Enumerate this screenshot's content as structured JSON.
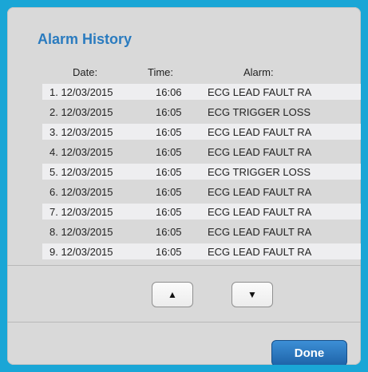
{
  "dialog": {
    "title": "Alarm History",
    "columns": {
      "date": "Date:",
      "time": "Time:",
      "alarm": "Alarm:"
    },
    "rows": [
      {
        "date": "1. 12/03/2015",
        "time": "16:06",
        "alarm": "ECG LEAD FAULT RA"
      },
      {
        "date": "2. 12/03/2015",
        "time": "16:05",
        "alarm": "ECG TRIGGER LOSS"
      },
      {
        "date": "3. 12/03/2015",
        "time": "16:05",
        "alarm": "ECG LEAD FAULT RA"
      },
      {
        "date": "4. 12/03/2015",
        "time": "16:05",
        "alarm": "ECG LEAD FAULT RA"
      },
      {
        "date": "5. 12/03/2015",
        "time": "16:05",
        "alarm": "ECG TRIGGER LOSS"
      },
      {
        "date": "6. 12/03/2015",
        "time": "16:05",
        "alarm": "ECG LEAD FAULT RA"
      },
      {
        "date": "7. 12/03/2015",
        "time": "16:05",
        "alarm": "ECG LEAD FAULT RA"
      },
      {
        "date": "8. 12/03/2015",
        "time": "16:05",
        "alarm": "ECG LEAD FAULT RA"
      },
      {
        "date": "9. 12/03/2015",
        "time": "16:05",
        "alarm": "ECG LEAD FAULT RA"
      }
    ],
    "scroll_up_label": "▲",
    "scroll_down_label": "▼",
    "done_label": "Done"
  },
  "colors": {
    "frame": "#1aa6d6",
    "title": "#2a7bbf",
    "done_button": "#2a78c2"
  }
}
